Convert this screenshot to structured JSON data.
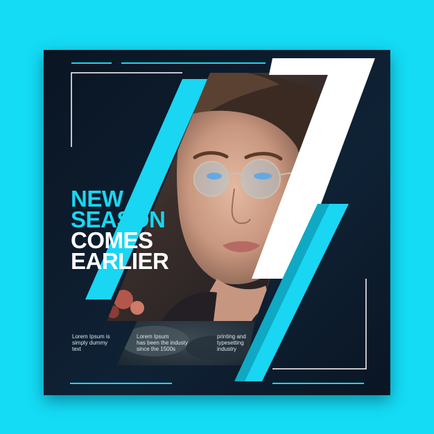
{
  "colors": {
    "background": "#14dcf5",
    "card": "#0c1a2a",
    "accent": "#19d6f2",
    "frame_white": "#ffffff"
  },
  "headline": {
    "line1": "NEW",
    "line2": "SEASON",
    "line3": "COMES",
    "line4": "EARLIER"
  },
  "columns": [
    {
      "line1": "Lorem Ipsum is",
      "line2": "simply dummy",
      "line3": "text"
    },
    {
      "line1": "Lorem Ipsum",
      "line2": "has been the industy",
      "line3": "since the 1500s"
    },
    {
      "line1": "printing and",
      "line2": "typesetting",
      "line3": "industry"
    }
  ],
  "photo": {
    "subject": "woman-with-glasses-portrait"
  }
}
